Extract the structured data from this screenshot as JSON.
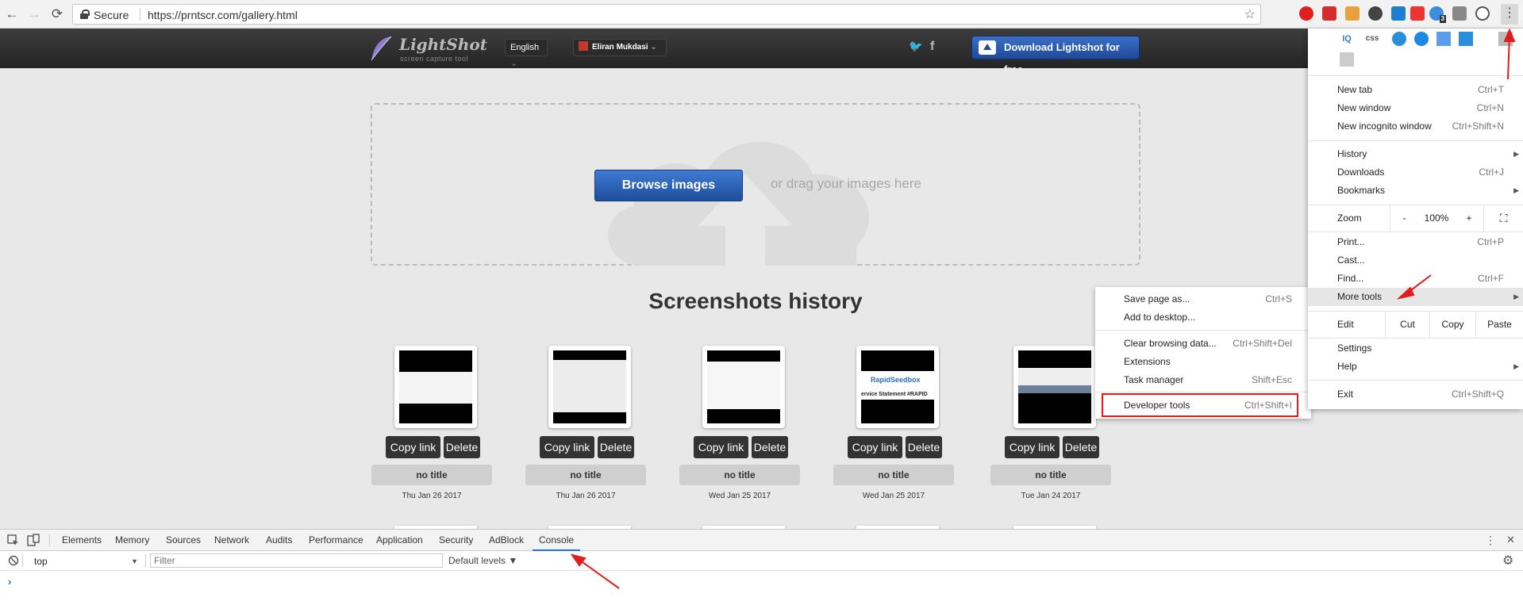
{
  "browser": {
    "back": "←",
    "forward": "→",
    "reload": "⟳",
    "secure_label": "Secure",
    "url": "https://prntscr.com/gallery.html",
    "star": "☆",
    "menu_glyph": "⋮",
    "ext_badge": "3"
  },
  "site": {
    "logo_name": "LightShot",
    "logo_sub": "screen capture tool",
    "language": "English",
    "user": "Eliran Mukdasi",
    "dropdown_caret": "⌄",
    "twitter": "🐦",
    "facebook": "f",
    "download_label": "Download Lightshot for free"
  },
  "upload": {
    "browse_label": "Browse images",
    "drag_text": "or drag your images here"
  },
  "history": {
    "title": "Screenshots history",
    "copy_label": "Copy link",
    "delete_label": "Delete",
    "items": [
      {
        "title": "no title",
        "date": "Thu Jan 26 2017"
      },
      {
        "title": "no title",
        "date": "Thu Jan 26 2017"
      },
      {
        "title": "no title",
        "date": "Wed Jan 25 2017"
      },
      {
        "title": "no title",
        "date": "Wed Jan 25 2017"
      },
      {
        "title": "no title",
        "date": "Tue Jan 24 2017"
      }
    ],
    "thumb4_brand": "RapidSeedbox",
    "thumb4_text": "ervice Statement #RAPID"
  },
  "chrome_menu": {
    "ext_labels": [
      "IQ",
      "css"
    ],
    "new_tab": {
      "label": "New tab",
      "shortcut": "Ctrl+T"
    },
    "new_window": {
      "label": "New window",
      "shortcut": "Ctrl+N"
    },
    "incognito": {
      "label": "New incognito window",
      "shortcut": "Ctrl+Shift+N"
    },
    "history": {
      "label": "History"
    },
    "downloads": {
      "label": "Downloads",
      "shortcut": "Ctrl+J"
    },
    "bookmarks": {
      "label": "Bookmarks"
    },
    "zoom": {
      "label": "Zoom",
      "minus": "-",
      "value": "100%",
      "plus": "+",
      "fullscreen": "⛶"
    },
    "print": {
      "label": "Print...",
      "shortcut": "Ctrl+P"
    },
    "cast": {
      "label": "Cast..."
    },
    "find": {
      "label": "Find...",
      "shortcut": "Ctrl+F"
    },
    "more_tools": {
      "label": "More tools"
    },
    "edit": {
      "label": "Edit",
      "cut": "Cut",
      "copy": "Copy",
      "paste": "Paste"
    },
    "settings": {
      "label": "Settings"
    },
    "help": {
      "label": "Help"
    },
    "exit": {
      "label": "Exit",
      "shortcut": "Ctrl+Shift+Q"
    },
    "submenu_arrow": "▶"
  },
  "more_tools_menu": {
    "save_page": {
      "label": "Save page as...",
      "shortcut": "Ctrl+S"
    },
    "add_desktop": {
      "label": "Add to desktop..."
    },
    "clear_data": {
      "label": "Clear browsing data...",
      "shortcut": "Ctrl+Shift+Del"
    },
    "extensions": {
      "label": "Extensions"
    },
    "task_manager": {
      "label": "Task manager",
      "shortcut": "Shift+Esc"
    },
    "dev_tools": {
      "label": "Developer tools",
      "shortcut": "Ctrl+Shift+I"
    }
  },
  "devtools": {
    "tabs": [
      "Elements",
      "Memory",
      "Sources",
      "Network",
      "Audits",
      "Performance",
      "Application",
      "Security",
      "AdBlock",
      "Console"
    ],
    "active_tab": "Console",
    "context": "top",
    "context_caret": "▼",
    "filter_placeholder": "Filter",
    "levels": "Default levels ▼",
    "prompt": "›",
    "more": "⋮",
    "close": "✕",
    "settings": "⚙"
  },
  "colors": {
    "accent_blue": "#1f4e9c",
    "annotation_red": "#e01c1c",
    "devtools_active": "#1a73e8"
  }
}
